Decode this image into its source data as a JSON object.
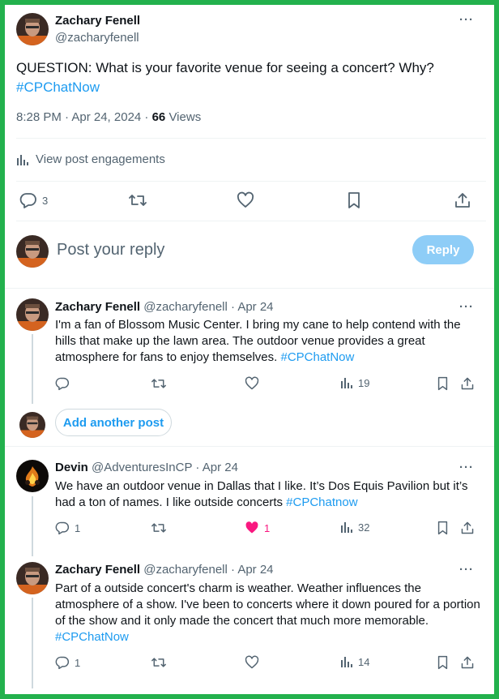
{
  "main_post": {
    "author_name": "Zachary Fenell",
    "author_handle": "@zacharyfenell",
    "text": "QUESTION: What is your favorite venue for seeing a concert? Why?",
    "hashtag": "#CPChatNow",
    "time": "8:28 PM · Apr 24, 2024 · ",
    "views_count": "66",
    "views_label": " Views",
    "engagements_label": "View post engagements",
    "replies": "3"
  },
  "compose": {
    "placeholder": "Post your reply",
    "reply_button": "Reply"
  },
  "replies": [
    {
      "author_name": "Zachary Fenell",
      "author_handle": "@zacharyfenell",
      "date": "· Apr 24",
      "text": "I'm a fan of Blossom Music Center. I bring my cane to help contend with the hills that make up the lawn area. The outdoor venue provides a great atmosphere for fans to enjoy themselves. ",
      "hashtag": "#CPChatNow",
      "replies": "",
      "likes": "",
      "views": "19"
    },
    {
      "author_name": "Devin",
      "author_handle": "@AdventuresInCP",
      "date": "· Apr 24",
      "text": "We have an outdoor venue in Dallas that I like. It’s Dos Equis Pavilion but it’s had a ton of names. I like outside concerts ",
      "hashtag": "#CPChatnow",
      "replies": "1",
      "likes": "1",
      "views": "32"
    },
    {
      "author_name": "Zachary Fenell",
      "author_handle": "@zacharyfenell",
      "date": "· Apr 24",
      "text": "Part of a outside concert's charm is weather. Weather influences the atmosphere of a show. I've been to concerts where it down poured for a portion of the show and it only made the concert that much more memorable. ",
      "hashtag": "#CPChatNow",
      "replies": "1",
      "likes": "",
      "views": "14"
    }
  ],
  "add_another_post": "Add another post",
  "more_label": "···",
  "colors": {
    "accent": "#1d9bf0",
    "like_active": "#f91880",
    "border": "#23b14d"
  }
}
